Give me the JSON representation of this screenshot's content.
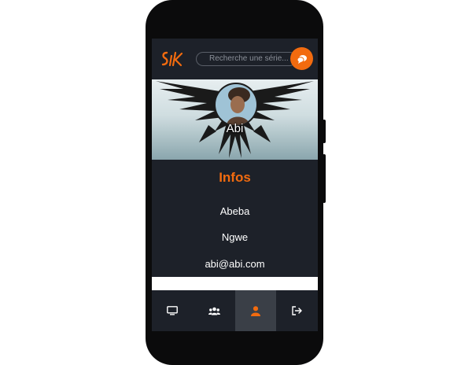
{
  "app": {
    "logo_text": "SiK"
  },
  "search": {
    "placeholder": "Recherche une série..."
  },
  "profile": {
    "username": "Abi"
  },
  "infos": {
    "title": "Infos",
    "first_name": "Abeba",
    "last_name": "Ngwe",
    "email": "abi@abi.com"
  },
  "bottom_nav": {
    "items": [
      {
        "icon": "tv-icon",
        "active": false
      },
      {
        "icon": "users-icon",
        "active": false
      },
      {
        "icon": "user-icon",
        "active": true
      },
      {
        "icon": "logout-icon",
        "active": false
      }
    ]
  },
  "colors": {
    "accent": "#f26b0f",
    "background": "#1d2129",
    "active_tab": "#3a3f47"
  }
}
